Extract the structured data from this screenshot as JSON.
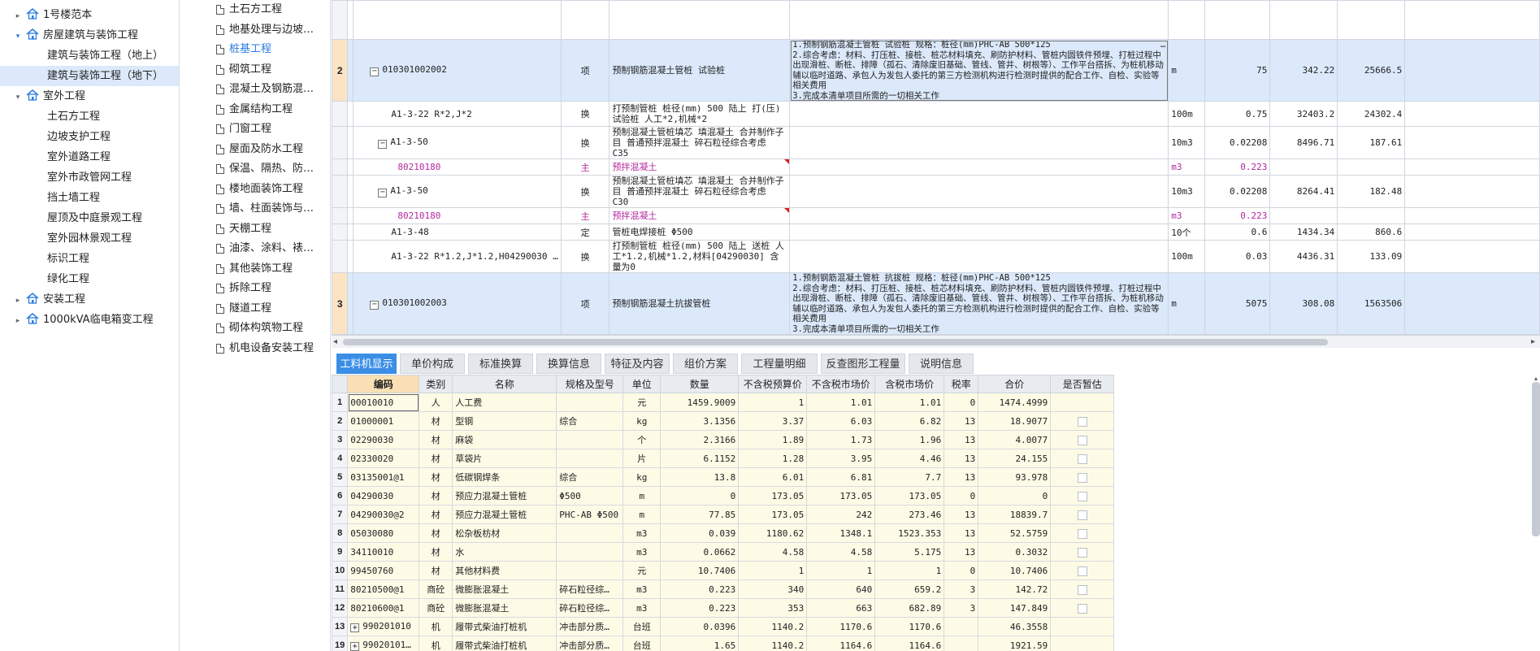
{
  "tree": {
    "items": [
      {
        "label": "1号楼范本",
        "level": 0,
        "arrow": "▸",
        "home": true,
        "sel": false
      },
      {
        "label": "房屋建筑与装饰工程",
        "level": 0,
        "arrow": "▾",
        "home": true,
        "sel": false,
        "arrowColor": "#2a7de1"
      },
      {
        "label": "建筑与装饰工程（地上）",
        "level": 1,
        "arrow": "",
        "home": false,
        "sel": false
      },
      {
        "label": "建筑与装饰工程（地下）",
        "level": 1,
        "arrow": "",
        "home": false,
        "sel": true
      },
      {
        "label": "室外工程",
        "level": 0,
        "arrow": "▾",
        "home": true,
        "sel": false
      },
      {
        "label": "土石方工程",
        "level": 1,
        "arrow": "",
        "home": false,
        "sel": false
      },
      {
        "label": "边坡支护工程",
        "level": 1,
        "arrow": "",
        "home": false,
        "sel": false
      },
      {
        "label": "室外道路工程",
        "level": 1,
        "arrow": "",
        "home": false,
        "sel": false
      },
      {
        "label": "室外市政管网工程",
        "level": 1,
        "arrow": "",
        "home": false,
        "sel": false
      },
      {
        "label": "挡土墙工程",
        "level": 1,
        "arrow": "",
        "home": false,
        "sel": false
      },
      {
        "label": "屋顶及中庭景观工程",
        "level": 1,
        "arrow": "",
        "home": false,
        "sel": false
      },
      {
        "label": "室外园林景观工程",
        "level": 1,
        "arrow": "",
        "home": false,
        "sel": false
      },
      {
        "label": "标识工程",
        "level": 1,
        "arrow": "",
        "home": false,
        "sel": false
      },
      {
        "label": "绿化工程",
        "level": 1,
        "arrow": "",
        "home": false,
        "sel": false
      },
      {
        "label": "安装工程",
        "level": 0,
        "arrow": "▸",
        "home": true,
        "sel": false
      },
      {
        "label": "1000kVA临电箱变工程",
        "level": 0,
        "arrow": "▸",
        "home": true,
        "sel": false
      }
    ]
  },
  "midlist": {
    "items": [
      {
        "label": "土石方工程",
        "active": false
      },
      {
        "label": "地基处理与边坡…",
        "active": false
      },
      {
        "label": "桩基工程",
        "active": true
      },
      {
        "label": "砌筑工程",
        "active": false
      },
      {
        "label": "混凝土及钢筋混…",
        "active": false
      },
      {
        "label": "金属结构工程",
        "active": false
      },
      {
        "label": "门窗工程",
        "active": false
      },
      {
        "label": "屋面及防水工程",
        "active": false
      },
      {
        "label": "保温、隔热、防…",
        "active": false
      },
      {
        "label": "楼地面装饰工程",
        "active": false
      },
      {
        "label": "墙、柱面装饰与…",
        "active": false
      },
      {
        "label": "天棚工程",
        "active": false
      },
      {
        "label": "油漆、涂料、裱…",
        "active": false
      },
      {
        "label": "其他装饰工程",
        "active": false
      },
      {
        "label": "拆除工程",
        "active": false
      },
      {
        "label": "隧道工程",
        "active": false
      },
      {
        "label": "砌体构筑物工程",
        "active": false
      },
      {
        "label": "机电设备安装工程",
        "active": false
      }
    ]
  },
  "upper": {
    "rows": [
      {
        "rn": "",
        "code": "",
        "type": "",
        "name": "",
        "desc": "",
        "unit": "",
        "qty": "",
        "price": "",
        "total": "",
        "kind": "top"
      },
      {
        "rn": "2",
        "code": "010301002002",
        "type": "项",
        "name": "预制钢筋混凝土管桩 试验桩",
        "desc": "1.预制钢筋混凝土管桩 试验桩 规格：桩径(mm)PHC-AB 500*125\n2.综合考虑：材料、打压桩、接桩、桩芯材料填充、刷防护材料、管桩内圆铁件预埋、打桩过程中出现滑桩、断桩、排障（孤石、清除废旧基础、管线、管井、树根等）、工作平台搭拆、为桩机移动辅以临时道路、承包人为发包人委托的第三方检测机构进行检测时提供的配合工作、自检、实验等相关费用\n3.完成本清单项目所需的一切相关工作",
        "unit": "m",
        "qty": "75",
        "price": "342.22",
        "total": "25666.5",
        "kind": "item"
      },
      {
        "rn": "",
        "code": "A1-3-22 R*2,J*2",
        "type": "换",
        "name": "打预制管桩 桩径(mm) 500 陆上  打(压)试验桩 人工*2,机械*2",
        "desc": "",
        "unit": "100m",
        "qty": "0.75",
        "price": "32403.2",
        "total": "24302.4",
        "kind": "sub"
      },
      {
        "rn": "",
        "code": "A1-3-50",
        "type": "换",
        "name": "预制混凝土管桩填芯 填混凝土  合并制作子目 普通预拌混凝土 碎石粒径综合考虑 C35",
        "desc": "",
        "unit": "10m3",
        "qty": "0.02208",
        "price": "8496.71",
        "total": "187.61",
        "kind": "sub2"
      },
      {
        "rn": "",
        "code": "80210180",
        "type": "主",
        "name": "预拌混凝土",
        "desc": "",
        "unit": "m3",
        "qty": "0.223",
        "price": "",
        "total": "",
        "kind": "main"
      },
      {
        "rn": "",
        "code": "A1-3-50",
        "type": "换",
        "name": "预制混凝土管桩填芯 填混凝土  合并制作子目 普通预拌混凝土 碎石粒径综合考虑 C30",
        "desc": "",
        "unit": "10m3",
        "qty": "0.02208",
        "price": "8264.41",
        "total": "182.48",
        "kind": "sub2"
      },
      {
        "rn": "",
        "code": "80210180",
        "type": "主",
        "name": "预拌混凝土",
        "desc": "",
        "unit": "m3",
        "qty": "0.223",
        "price": "",
        "total": "",
        "kind": "main"
      },
      {
        "rn": "",
        "code": "A1-3-48",
        "type": "定",
        "name": "管桩电焊接桩 Φ500",
        "desc": "",
        "unit": "10个",
        "qty": "0.6",
        "price": "1434.34",
        "total": "860.6",
        "kind": "sub"
      },
      {
        "rn": "",
        "code": "A1-3-22 R*1.2,J*1.2,H04290030 …",
        "type": "换",
        "name": "打预制管桩 桩径(mm) 500 陆上  送桩 人工*1.2,机械*1.2,材料[04290030] 含量为0",
        "desc": "",
        "unit": "100m",
        "qty": "0.03",
        "price": "4436.31",
        "total": "133.09",
        "kind": "sub"
      },
      {
        "rn": "3",
        "code": "010301002003",
        "type": "项",
        "name": "预制钢筋混凝土抗拔管桩",
        "desc": "1.预制钢筋混凝土管桩 抗拔桩 规格：桩径(mm)PHC-AB 500*125\n2.综合考虑：材料、打压桩、接桩、桩芯材料填充、刷防护材料、管桩内圆铁件预埋、打桩过程中出现滑桩、断桩、排障（孤石、清除废旧基础、管线、管井、树根等）、工作平台搭拆、为桩机移动辅以临时道路、承包人为发包人委托的第三方检测机构进行检测时提供的配合工作、自检、实验等相关费用\n3.完成本清单项目所需的一切相关工作",
        "unit": "m",
        "qty": "5075",
        "price": "308.08",
        "total": "1563506",
        "kind": "item"
      }
    ]
  },
  "tabs": [
    {
      "label": "工料机显示",
      "active": true
    },
    {
      "label": "单价构成",
      "active": false
    },
    {
      "label": "标准换算",
      "active": false
    },
    {
      "label": "换算信息",
      "active": false
    },
    {
      "label": "特征及内容",
      "active": false
    },
    {
      "label": "组价方案",
      "active": false
    },
    {
      "label": "工程量明细",
      "active": false
    },
    {
      "label": "反查图形工程量",
      "active": false
    },
    {
      "label": "说明信息",
      "active": false
    }
  ],
  "lower": {
    "headers": [
      "编码",
      "类别",
      "名称",
      "规格及型号",
      "单位",
      "数量",
      "不含税预算价",
      "不含税市场价",
      "含税市场价",
      "税率",
      "合价",
      "是否暂估"
    ],
    "rows": [
      {
        "rn": "1",
        "code": "00010010",
        "cat": "人",
        "name": "人工费",
        "spec": "",
        "unit": "元",
        "qty": "1459.9009",
        "p1": "1",
        "p2": "1.01",
        "p3": "1.01",
        "tax": "0",
        "sum": "1474.4999",
        "chk": false,
        "plus": false
      },
      {
        "rn": "2",
        "code": "01000001",
        "cat": "材",
        "name": "型钢",
        "spec": "综合",
        "unit": "kg",
        "qty": "3.1356",
        "p1": "3.37",
        "p2": "6.03",
        "p3": "6.82",
        "tax": "13",
        "sum": "18.9077",
        "chk": true,
        "plus": false
      },
      {
        "rn": "3",
        "code": "02290030",
        "cat": "材",
        "name": "麻袋",
        "spec": "",
        "unit": "个",
        "qty": "2.3166",
        "p1": "1.89",
        "p2": "1.73",
        "p3": "1.96",
        "tax": "13",
        "sum": "4.0077",
        "chk": true,
        "plus": false
      },
      {
        "rn": "4",
        "code": "02330020",
        "cat": "材",
        "name": "草袋片",
        "spec": "",
        "unit": "片",
        "qty": "6.1152",
        "p1": "1.28",
        "p2": "3.95",
        "p3": "4.46",
        "tax": "13",
        "sum": "24.155",
        "chk": true,
        "plus": false
      },
      {
        "rn": "5",
        "code": "03135001@1",
        "cat": "材",
        "name": "低碳钢焊条",
        "spec": "综合",
        "unit": "kg",
        "qty": "13.8",
        "p1": "6.01",
        "p2": "6.81",
        "p3": "7.7",
        "tax": "13",
        "sum": "93.978",
        "chk": true,
        "plus": false
      },
      {
        "rn": "6",
        "code": "04290030",
        "cat": "材",
        "name": "预应力混凝土管桩",
        "spec": "Φ500",
        "unit": "m",
        "qty": "0",
        "p1": "173.05",
        "p2": "173.05",
        "p3": "173.05",
        "tax": "0",
        "sum": "0",
        "chk": true,
        "plus": false
      },
      {
        "rn": "7",
        "code": "04290030@2",
        "cat": "材",
        "name": "预应力混凝土管桩",
        "spec": "PHC-AB Φ500",
        "unit": "m",
        "qty": "77.85",
        "p1": "173.05",
        "p2": "242",
        "p3": "273.46",
        "tax": "13",
        "sum": "18839.7",
        "chk": true,
        "plus": false
      },
      {
        "rn": "8",
        "code": "05030080",
        "cat": "材",
        "name": "松杂板枋材",
        "spec": "",
        "unit": "m3",
        "qty": "0.039",
        "p1": "1180.62",
        "p2": "1348.1",
        "p3": "1523.353",
        "tax": "13",
        "sum": "52.5759",
        "chk": true,
        "plus": false
      },
      {
        "rn": "9",
        "code": "34110010",
        "cat": "材",
        "name": "水",
        "spec": "",
        "unit": "m3",
        "qty": "0.0662",
        "p1": "4.58",
        "p2": "4.58",
        "p3": "5.175",
        "tax": "13",
        "sum": "0.3032",
        "chk": true,
        "plus": false
      },
      {
        "rn": "10",
        "code": "99450760",
        "cat": "材",
        "name": "其他材料费",
        "spec": "",
        "unit": "元",
        "qty": "10.7406",
        "p1": "1",
        "p2": "1",
        "p3": "1",
        "tax": "0",
        "sum": "10.7406",
        "chk": true,
        "plus": false
      },
      {
        "rn": "11",
        "code": "80210500@1",
        "cat": "商砼",
        "name": "微膨胀混凝土",
        "spec": "碎石粒径综…",
        "unit": "m3",
        "qty": "0.223",
        "p1": "340",
        "p2": "640",
        "p3": "659.2",
        "tax": "3",
        "sum": "142.72",
        "chk": true,
        "plus": false
      },
      {
        "rn": "12",
        "code": "80210600@1",
        "cat": "商砼",
        "name": "微膨胀混凝土",
        "spec": "碎石粒径综…",
        "unit": "m3",
        "qty": "0.223",
        "p1": "353",
        "p2": "663",
        "p3": "682.89",
        "tax": "3",
        "sum": "147.849",
        "chk": true,
        "plus": false
      },
      {
        "rn": "13",
        "code": "990201010",
        "cat": "机",
        "name": "履带式柴油打桩机",
        "spec": "冲击部分质…",
        "unit": "台班",
        "qty": "0.0396",
        "p1": "1140.2",
        "p2": "1170.6",
        "p3": "1170.6",
        "tax": "",
        "sum": "46.3558",
        "chk": false,
        "plus": true
      },
      {
        "rn": "19",
        "code": "99020101…",
        "cat": "机",
        "name": "履带式柴油打桩机",
        "spec": "冲击部分质…",
        "unit": "台班",
        "qty": "1.65",
        "p1": "1140.2",
        "p2": "1164.6",
        "p3": "1164.6",
        "tax": "",
        "sum": "1921.59",
        "chk": false,
        "plus": true
      }
    ]
  }
}
